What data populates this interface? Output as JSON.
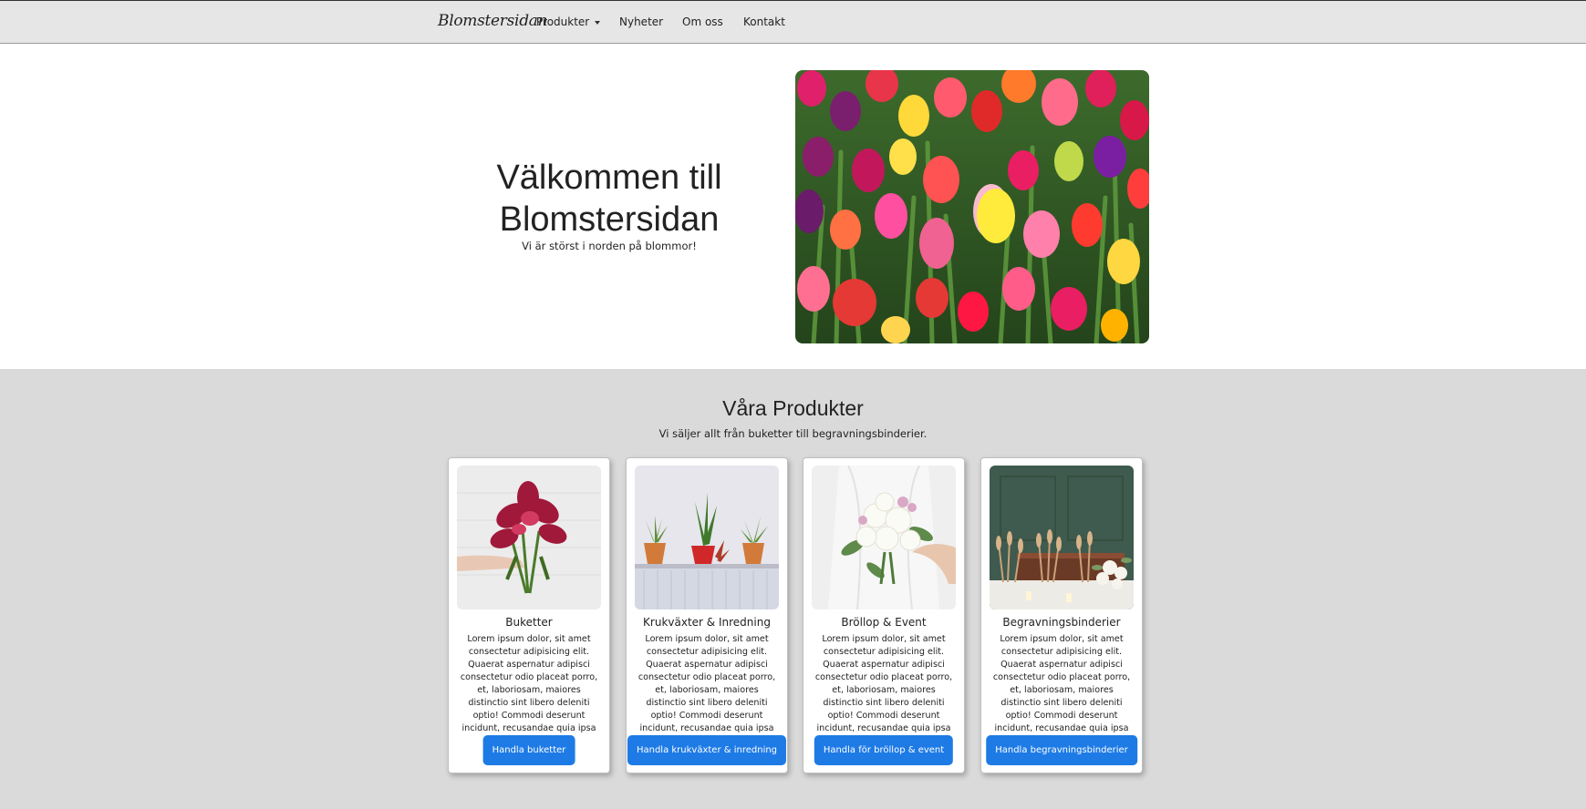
{
  "nav": {
    "brand": "Blomstersidan",
    "items": [
      "Produkter",
      "Nyheter",
      "Om oss",
      "Kontakt"
    ]
  },
  "hero": {
    "title_line1": "Välkommen till",
    "title_line2": "Blomstersidan",
    "subtitle": "Vi är störst i norden på blommor!"
  },
  "products": {
    "title": "Våra Produkter",
    "subtitle": "Vi säljer allt från buketter till begravningsbinderier.",
    "cards": [
      {
        "title": "Buketter",
        "text": "Lorem ipsum dolor, sit amet consectetur adipisicing elit. Quaerat aspernatur adipisci consectetur odio placeat porro, et, laboriosam, maiores distinctio sint libero deleniti optio! Commodi deserunt incidunt, recusandae quia ipsa dicta!",
        "button": "Handla buketter"
      },
      {
        "title": "Krukväxter & Inredning",
        "text": "Lorem ipsum dolor, sit amet consectetur adipisicing elit. Quaerat aspernatur adipisci consectetur odio placeat porro, et, laboriosam, maiores distinctio sint libero deleniti optio! Commodi deserunt incidunt, recusandae quia ipsa dicta!",
        "button": "Handla krukväxter & inredning"
      },
      {
        "title": "Bröllop & Event",
        "text": "Lorem ipsum dolor, sit amet consectetur adipisicing elit. Quaerat aspernatur adipisci consectetur odio placeat porro, et, laboriosam, maiores distinctio sint libero deleniti optio! Commodi deserunt incidunt, recusandae quia ipsa dicta!",
        "button": "Handla för bröllop & event"
      },
      {
        "title": "Begravningsbinderier",
        "text": "Lorem ipsum dolor, sit amet consectetur adipisicing elit. Quaerat aspernatur adipisci consectetur odio placeat porro, et, laboriosam, maiores distinctio sint libero deleniti optio! Commodi deserunt incidunt, recusandae quia ipsa dicta!",
        "button": "Handla begravningsbinderier"
      }
    ]
  },
  "colors": {
    "navbar_bg": "#e6e6e6",
    "section_bg": "#dadada",
    "button": "#1e7be6"
  }
}
